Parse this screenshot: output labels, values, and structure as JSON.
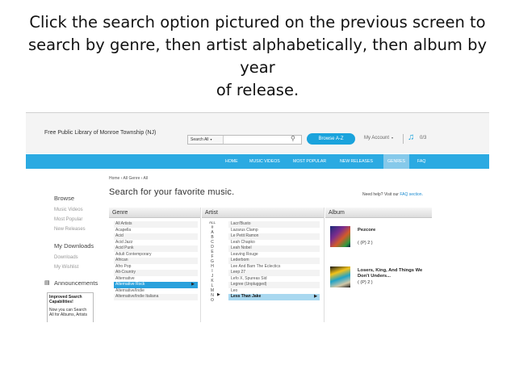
{
  "slide": {
    "line1": "Click the search option pictured on the previous screen to",
    "line2": "search by genre, then artist alphabetically, then album by year",
    "line3": "of release."
  },
  "header": {
    "library_name": "Free Public Library of Monroe Township (NJ)",
    "search_scope": "Search All",
    "search_value": "",
    "browse_button": "Browse A-Z",
    "account_label": "My Account",
    "download_count": "0/3"
  },
  "nav": {
    "items": [
      "HOME",
      "MUSIC VIDEOS",
      "MOST POPULAR",
      "NEW RELEASES",
      "GENRES",
      "FAQ"
    ],
    "active": "GENRES"
  },
  "page": {
    "breadcrumb": "Home › All Genre › All",
    "title": "Search for your favorite music.",
    "help_text": "Need help? Visit our",
    "help_link": "FAQ section."
  },
  "sidebar": {
    "browse": "Browse",
    "browse_links": [
      "Music Videos",
      "Most Popular",
      "New Releases"
    ],
    "my_downloads": "My Downloads",
    "download_links": [
      "Downloads",
      "My Wishlist"
    ],
    "announcements": "Announcements",
    "announcement_title": "Improved Search Capabilities!",
    "announcement_text": "Now you can Search All for Albums, Artists"
  },
  "columns": {
    "genre": "Genre",
    "artist": "Artist",
    "album": "Album"
  },
  "genres": [
    "All Artists",
    "Acapella",
    "Acid",
    "Acid Jazz",
    "Acid Punk",
    "Adult Contemporary",
    "African",
    "Afro Pop",
    "Alt-Country",
    "Alternative",
    "Alternative Rock",
    "Alternative/Indie",
    "Alternative/Indie Italiana"
  ],
  "selected_genre": "Alternative Rock",
  "letters": [
    "ALL",
    "#",
    "A",
    "B",
    "C",
    "D",
    "E",
    "F",
    "G",
    "H",
    "I",
    "J",
    "K",
    "L",
    "M",
    "N",
    "O"
  ],
  "selected_letter": "L",
  "artists": [
    "Lacri'Busto",
    "Lazarus Clamp",
    "Le Petit Ramon",
    "Leah Chapko",
    "Leah Nobel",
    "Leaving Rouge",
    "Lederbom",
    "Lee And Barn The Eclectics",
    "Leep 27",
    "Lefo X, Spureas Sid",
    "Legree (Unplugged)",
    "Leo",
    "Less Than Jake"
  ],
  "selected_artist": "Less Than Jake",
  "albums": [
    {
      "title": "Pezcore",
      "meta": "( (P) 2 )"
    },
    {
      "title": "Losers, King, And Things We Don't Unders...",
      "meta": "( (P) 2 )"
    }
  ]
}
